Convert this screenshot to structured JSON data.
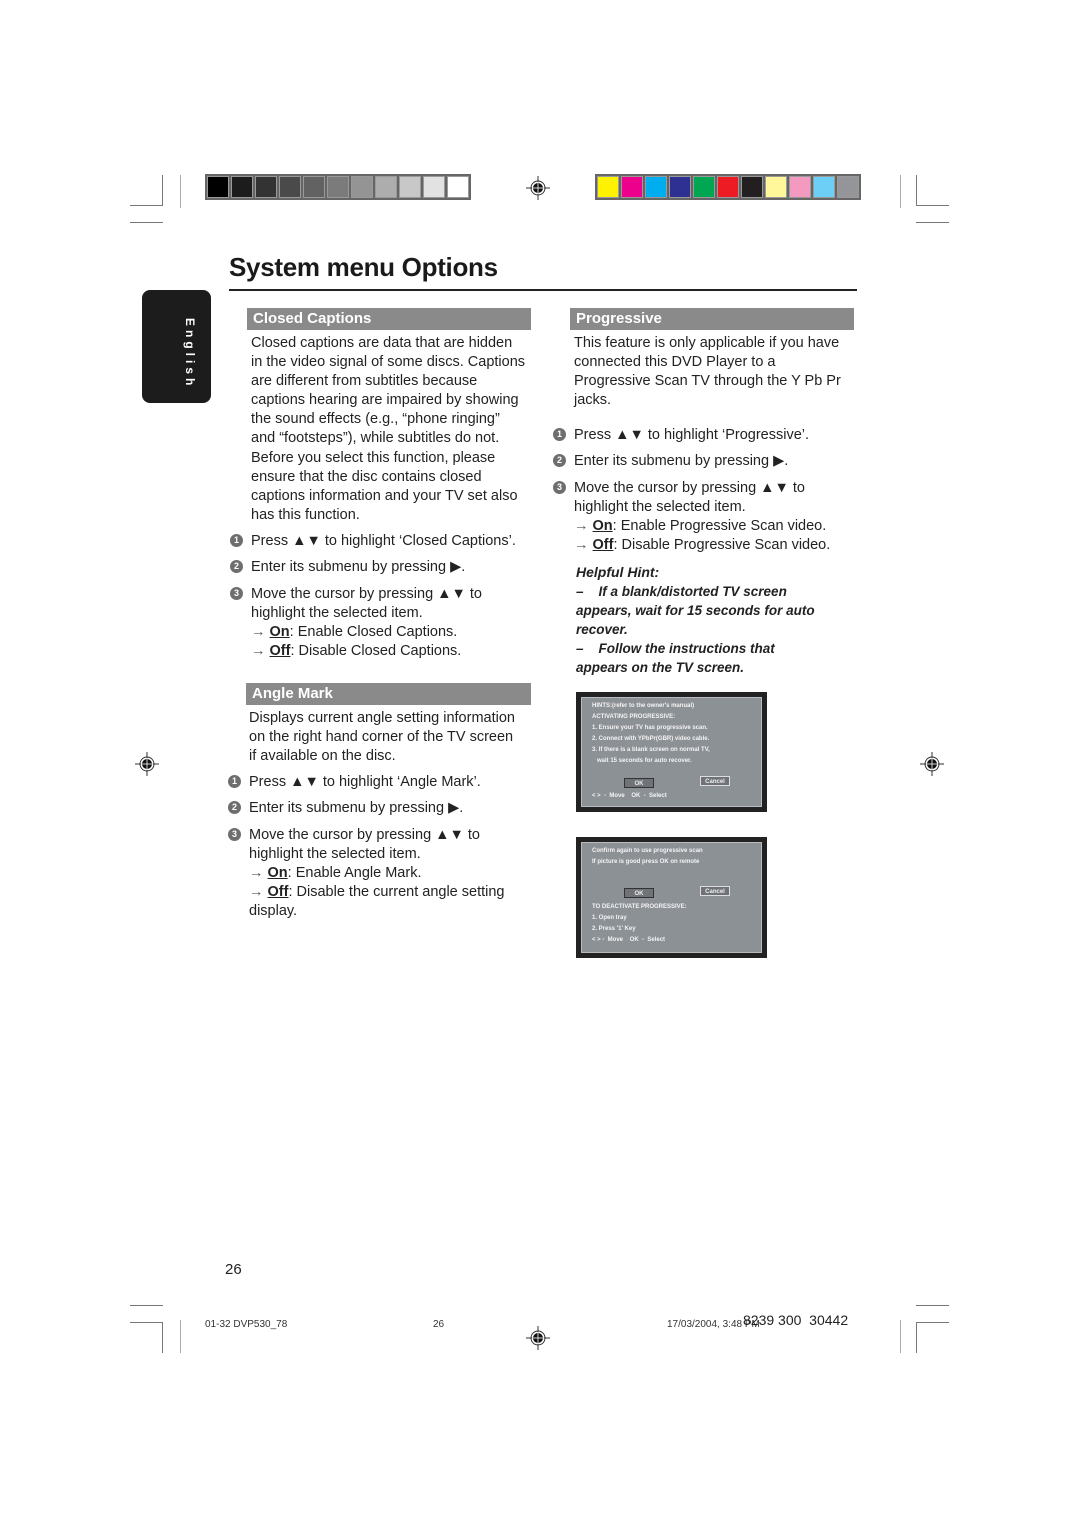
{
  "page": {
    "title": "System menu Options",
    "language_tab": "English",
    "page_number": "26"
  },
  "color_bars": {
    "grayscale": [
      "#000000",
      "#1c1c1c",
      "#333333",
      "#4a4a4a",
      "#626262",
      "#7b7b7b",
      "#949494",
      "#adadad",
      "#c8c8c8",
      "#e2e2e2",
      "#ffffff"
    ],
    "colors": [
      "#fff200",
      "#ec008c",
      "#00aeef",
      "#2e3192",
      "#00a651",
      "#ed1c24",
      "#231f20",
      "#fff799",
      "#f49ac1",
      "#6dcff6",
      "#939598"
    ]
  },
  "closed_captions": {
    "heading": "Closed Captions",
    "description": [
      "Closed captions are data that are hidden",
      "in the video signal of some discs. Captions",
      "are different from subtitles because",
      "captions hearing are impaired by showing",
      "the sound effects (e.g., “phone ringing”",
      "and “footsteps”), while subtitles do not.",
      "Before you select this function, please",
      "ensure that the disc contains closed",
      "captions information and your TV set also",
      "has this function."
    ],
    "steps": [
      {
        "num": "1",
        "text": "Press ▲▼ to highlight ‘Closed Captions’."
      },
      {
        "num": "2",
        "text": "Enter its submenu by pressing ▶."
      },
      {
        "num": "3",
        "text": "Move the cursor by pressing ▲▼ to",
        "text2": "highlight the selected item."
      }
    ],
    "options": [
      {
        "arrow": "→",
        "key": "On",
        "desc": ": Enable Closed Captions."
      },
      {
        "arrow": "→",
        "key": "Off",
        "desc": ": Disable Closed Captions."
      }
    ]
  },
  "angle_mark": {
    "heading": "Angle Mark",
    "description": [
      "Displays current angle setting information",
      "on the right hand corner of the TV screen",
      "if available on the disc."
    ],
    "steps": [
      {
        "num": "1",
        "text": "Press ▲▼ to highlight ‘Angle Mark’."
      },
      {
        "num": "2",
        "text": "Enter its submenu by pressing ▶."
      },
      {
        "num": "3",
        "text": "Move the cursor by pressing ▲▼ to",
        "text2": "highlight the selected item."
      }
    ],
    "options": [
      {
        "arrow": "→",
        "key": "On",
        "desc": ": Enable Angle Mark."
      },
      {
        "arrow": "→",
        "key": "Off",
        "desc": ": Disable the current angle setting",
        "desc2": "display."
      }
    ]
  },
  "progressive": {
    "heading": "Progressive",
    "description": [
      "This feature is only applicable if you have",
      "connected this DVD Player to a",
      "Progressive Scan TV through the Y Pb Pr",
      "jacks."
    ],
    "steps": [
      {
        "num": "1",
        "text": "Press ▲▼ to highlight ‘Progressive’."
      },
      {
        "num": "2",
        "text": "Enter its submenu by pressing ▶."
      },
      {
        "num": "3",
        "text": "Move the cursor by pressing ▲▼ to",
        "text2": "highlight the selected item."
      }
    ],
    "options": [
      {
        "arrow": "→",
        "key": "On",
        "desc": ": Enable Progressive Scan video."
      },
      {
        "arrow": "→",
        "key": "Off",
        "desc": ": Disable Progressive Scan video."
      }
    ],
    "hint": {
      "title": "Helpful Hint:",
      "lines": [
        "–    If a blank/distorted TV screen",
        "appears, wait for 15 seconds for auto",
        "recover.",
        "–    Follow the instructions that",
        "appears on the TV screen."
      ]
    }
  },
  "osd_screen_1": {
    "lines": [
      "HINTS:(refer to the owner's manual)",
      "ACTIVATING PROGRESSIVE:",
      "1. Ensure your TV has progressive scan.",
      "2. Connect with YPbPr(GBR) video cable.",
      "3. If there is a blank screen on normal TV,",
      "   wait 15 seconds for auto recover."
    ],
    "ok_label": "OK",
    "cancel_label": "Cancel",
    "nav": "< >  -  Move    OK  -  Select"
  },
  "osd_screen_2": {
    "lines": [
      "Confirm again to use progressive scan",
      "If picture is good press OK on remote"
    ],
    "ok_label": "OK",
    "cancel_label": "Cancel",
    "lines_after": [
      "TO DEACTIVATE PROGRESSIVE:",
      "1. Open tray",
      "2. Press '1' Key"
    ],
    "nav": "< > -  Move    OK  -  Select"
  },
  "footer": {
    "file": "01-32 DVP530_78",
    "page": "26",
    "timestamp": "17/03/2004, 3:48 PM",
    "code": "8239 300  30442"
  }
}
